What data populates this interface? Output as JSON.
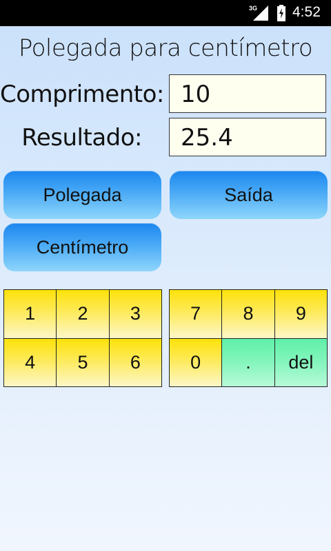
{
  "status_bar": {
    "network": "3G",
    "time": "4:52"
  },
  "title": "Polegada para centímetro",
  "length_label": "Comprimento:",
  "length_value": "10",
  "result_label": "Resultado:",
  "result_value": "25.4",
  "buttons": {
    "inch": "Polegada",
    "exit": "Saída",
    "centimeter": "Centímetro"
  },
  "keypad_left": [
    "1",
    "2",
    "3",
    "4",
    "5",
    "6"
  ],
  "keypad_right": [
    "7",
    "8",
    "9",
    "0",
    ".",
    "del"
  ],
  "colors": {
    "key_yellow": "#fde20a",
    "key_green": "#5ff0a8",
    "button_blue": "#1b86ee"
  }
}
